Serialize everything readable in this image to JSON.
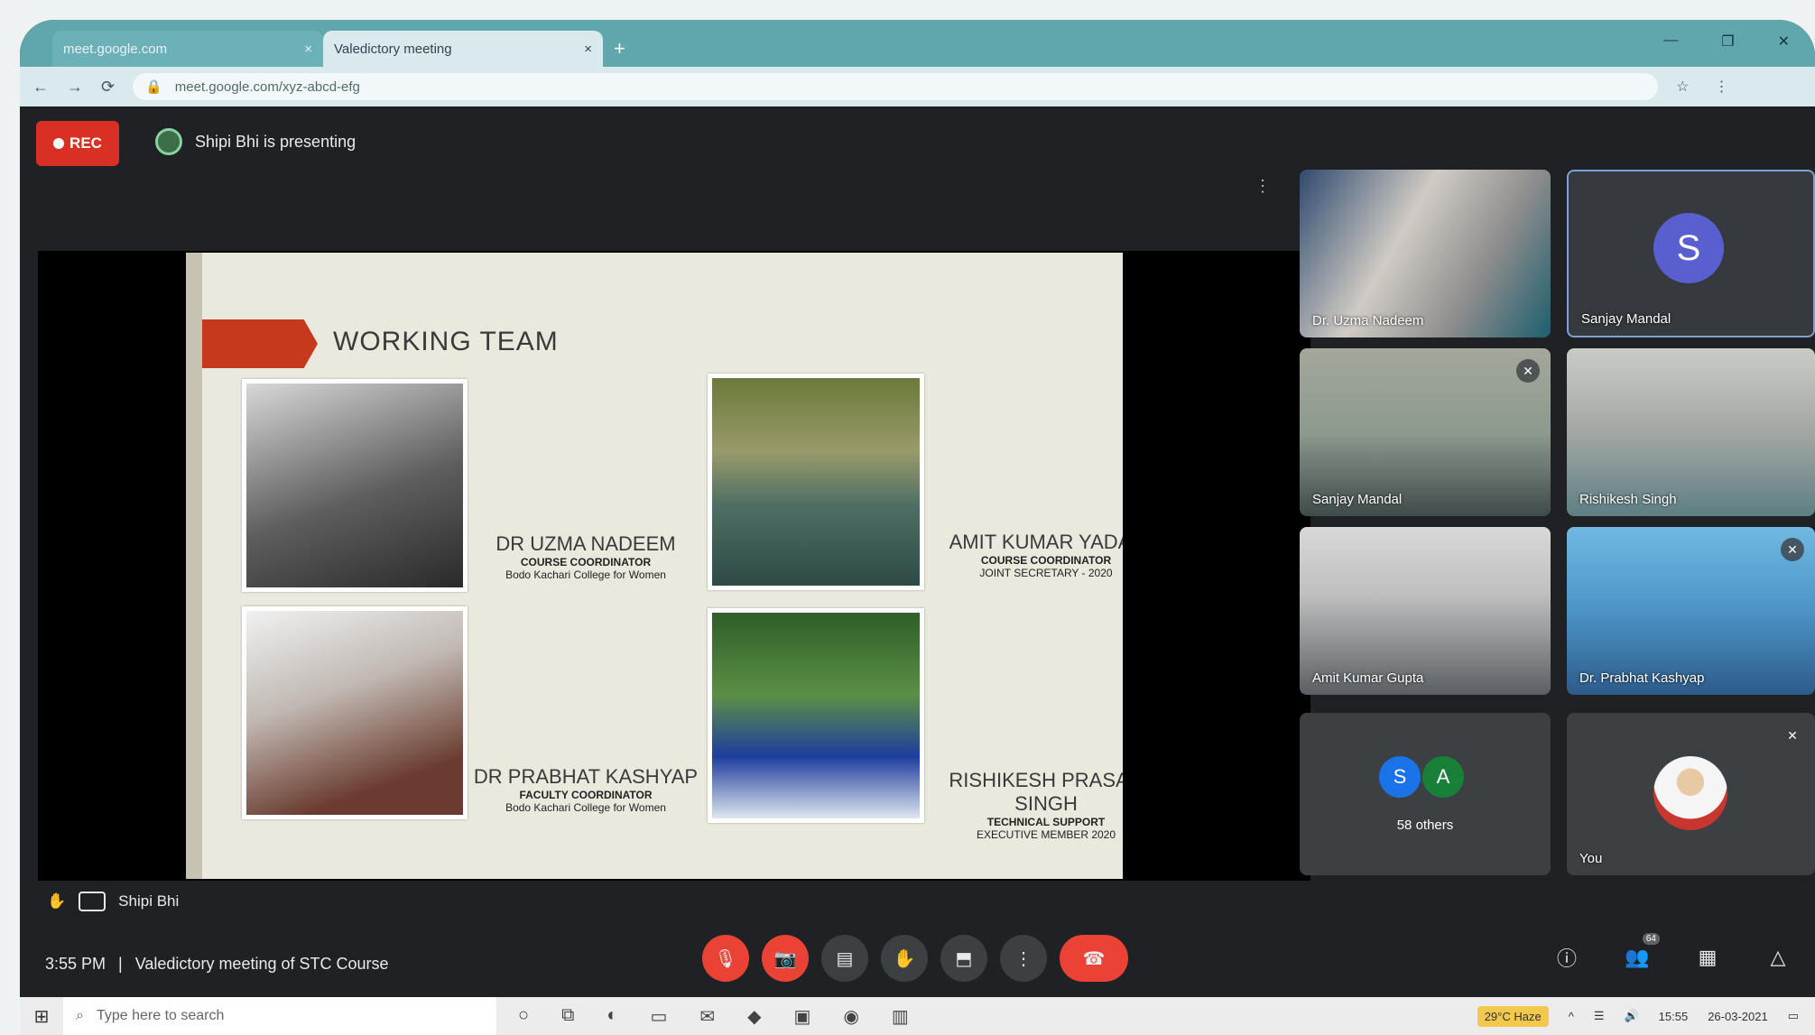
{
  "browser": {
    "tabs": [
      {
        "title": "meet.google.com",
        "close": "×"
      },
      {
        "title": "Valedictory meeting",
        "close": "×"
      }
    ],
    "new_tab": "+",
    "url": "meet.google.com/xyz-abcd-efg",
    "window_controls": [
      "—",
      "❐",
      "✕"
    ],
    "nav": [
      "←",
      "→",
      "⟳"
    ],
    "addr_right": [
      "☆",
      "⋮"
    ]
  },
  "meet": {
    "rec_label": "REC",
    "presenting_text": "Shipi Bhi is presenting",
    "slide": {
      "title": "WORKING TEAM",
      "members": [
        {
          "name": "DR UZMA NADEEM",
          "role": "COURSE COORDINATOR",
          "org": "Bodo Kachari College for Women"
        },
        {
          "name": "AMIT KUMAR YADAV",
          "role": "COURSE COORDINATOR",
          "org": "JOINT SECRETARY - 2020"
        },
        {
          "name": "DR PRABHAT KASHYAP",
          "role": "FACULTY COORDINATOR",
          "org": "Bodo Kachari College for Women"
        },
        {
          "name": "RISHIKESH PRASAD SINGH",
          "role": "TECHNICAL SUPPORT",
          "org": "EXECUTIVE MEMBER 2020"
        }
      ]
    },
    "tiles": [
      {
        "label": "Dr. Uzma Nadeem"
      },
      {
        "label": "Sanjay Mandal",
        "initial": "S"
      },
      {
        "label": "Sanjay Mandal"
      },
      {
        "label": "Rishikesh Singh"
      },
      {
        "label": "Amit Kumar Gupta"
      },
      {
        "label": "Dr. Prabhat Kashyap"
      },
      {
        "label": "58 others",
        "initials": [
          "S",
          "A"
        ]
      },
      {
        "label": "You"
      }
    ],
    "caption_text": "Shipi Bhi",
    "time": "3:55 PM",
    "separator": "|",
    "meeting_name": "Valedictory meeting of STC Course",
    "participant_count": "64"
  },
  "taskbar": {
    "search_placeholder": "Type here to search",
    "weather": "29°C Haze",
    "tray_time": "15:55",
    "tray_date": "26-03-2021"
  }
}
